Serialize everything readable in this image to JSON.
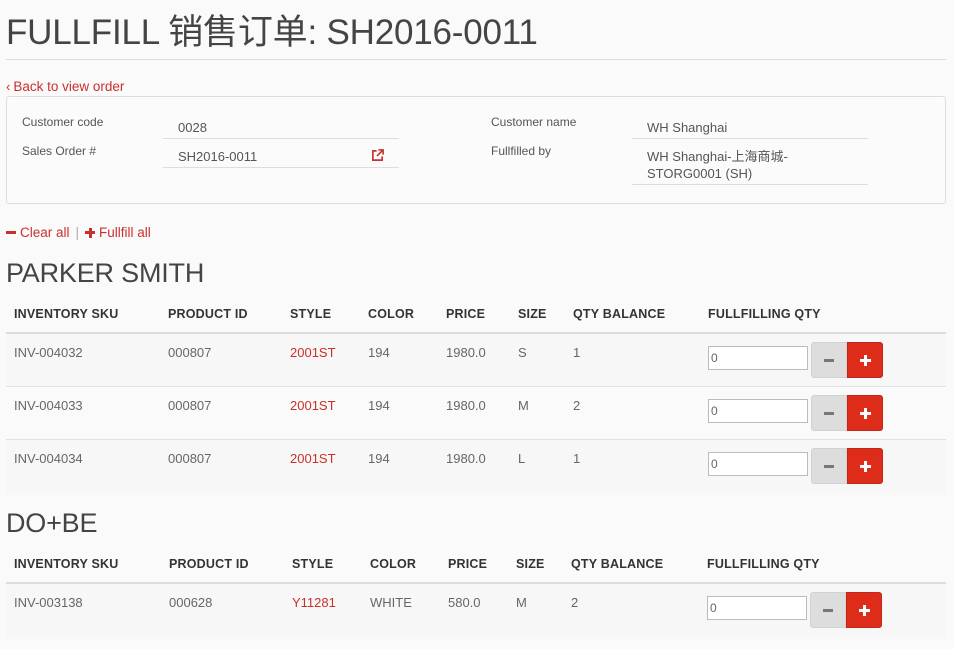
{
  "page": {
    "title": "FULLFILL 销售订单: SH2016-0011",
    "back_label": "Back to view order"
  },
  "order": {
    "customer_code_label": "Customer code",
    "customer_code": "0028",
    "sales_order_label": "Sales Order #",
    "sales_order": "SH2016-0011",
    "customer_name_label": "Customer name",
    "customer_name": "WH Shanghai",
    "fulfilled_by_label": "Fullfilled by",
    "fulfilled_by_line1": "WH Shanghai-上海商城-",
    "fulfilled_by_line2": "STORG0001 (SH)"
  },
  "actions": {
    "clear_all": "Clear all",
    "separator": "|",
    "fulfill_all": "Fullfill all"
  },
  "columns": {
    "sku": "INVENTORY SKU",
    "product_id": "PRODUCT ID",
    "style": "STYLE",
    "color": "COLOR",
    "price": "PRICE",
    "size": "SIZE",
    "qty_balance": "QTY BALANCE",
    "fulfilling_qty": "FULLFILLING QTY"
  },
  "groups": [
    {
      "brand": "PARKER SMITH",
      "rows": [
        {
          "sku": "INV-004032",
          "product_id": "000807",
          "style": "2001ST",
          "color": "194",
          "price": "1980.0",
          "size": "S",
          "qty_balance": "1",
          "qty": "0"
        },
        {
          "sku": "INV-004033",
          "product_id": "000807",
          "style": "2001ST",
          "color": "194",
          "price": "1980.0",
          "size": "M",
          "qty_balance": "2",
          "qty": "0"
        },
        {
          "sku": "INV-004034",
          "product_id": "000807",
          "style": "2001ST",
          "color": "194",
          "price": "1980.0",
          "size": "L",
          "qty_balance": "1",
          "qty": "0"
        }
      ]
    },
    {
      "brand": "DO+BE",
      "rows": [
        {
          "sku": "INV-003138",
          "product_id": "000628",
          "style": "Y11281",
          "color": "WHITE",
          "price": "580.0",
          "size": "M",
          "qty_balance": "2",
          "qty": "0"
        }
      ]
    }
  ],
  "icons": {
    "back": "chevron-left-icon",
    "external": "external-link-icon",
    "clear": "minus-icon",
    "fulfill": "plus-icon"
  },
  "colors": {
    "accent": "#c9302c",
    "plus_button": "#dd2c1a",
    "minus_button": "#dddddd"
  }
}
